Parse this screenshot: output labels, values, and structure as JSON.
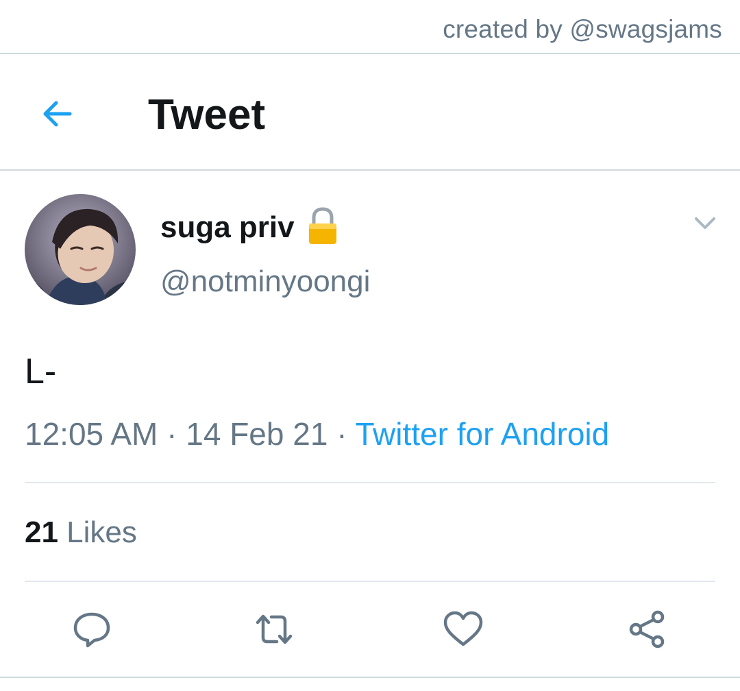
{
  "watermark": "created by @swagsjams",
  "header": {
    "title": "Tweet",
    "back_icon": "arrow-left-icon"
  },
  "tweet": {
    "author": {
      "display_name": "suga priv",
      "handle": "@notminyoongi",
      "protected_icon": "lock-icon"
    },
    "text": "L-",
    "timestamp": {
      "time": "12:05 AM",
      "separator": " · ",
      "date": "14 Feb 21",
      "source": "Twitter for Android"
    },
    "stats": {
      "likes_count": "21",
      "likes_label": " Likes"
    },
    "actions": [
      {
        "name": "reply",
        "icon": "comment-icon"
      },
      {
        "name": "retweet",
        "icon": "retweet-icon"
      },
      {
        "name": "like",
        "icon": "heart-icon"
      },
      {
        "name": "share",
        "icon": "share-icon"
      }
    ]
  },
  "colors": {
    "accent": "#1da1f2",
    "text_primary": "#14171a",
    "text_secondary": "#657786",
    "divider": "#e1e8ed"
  }
}
